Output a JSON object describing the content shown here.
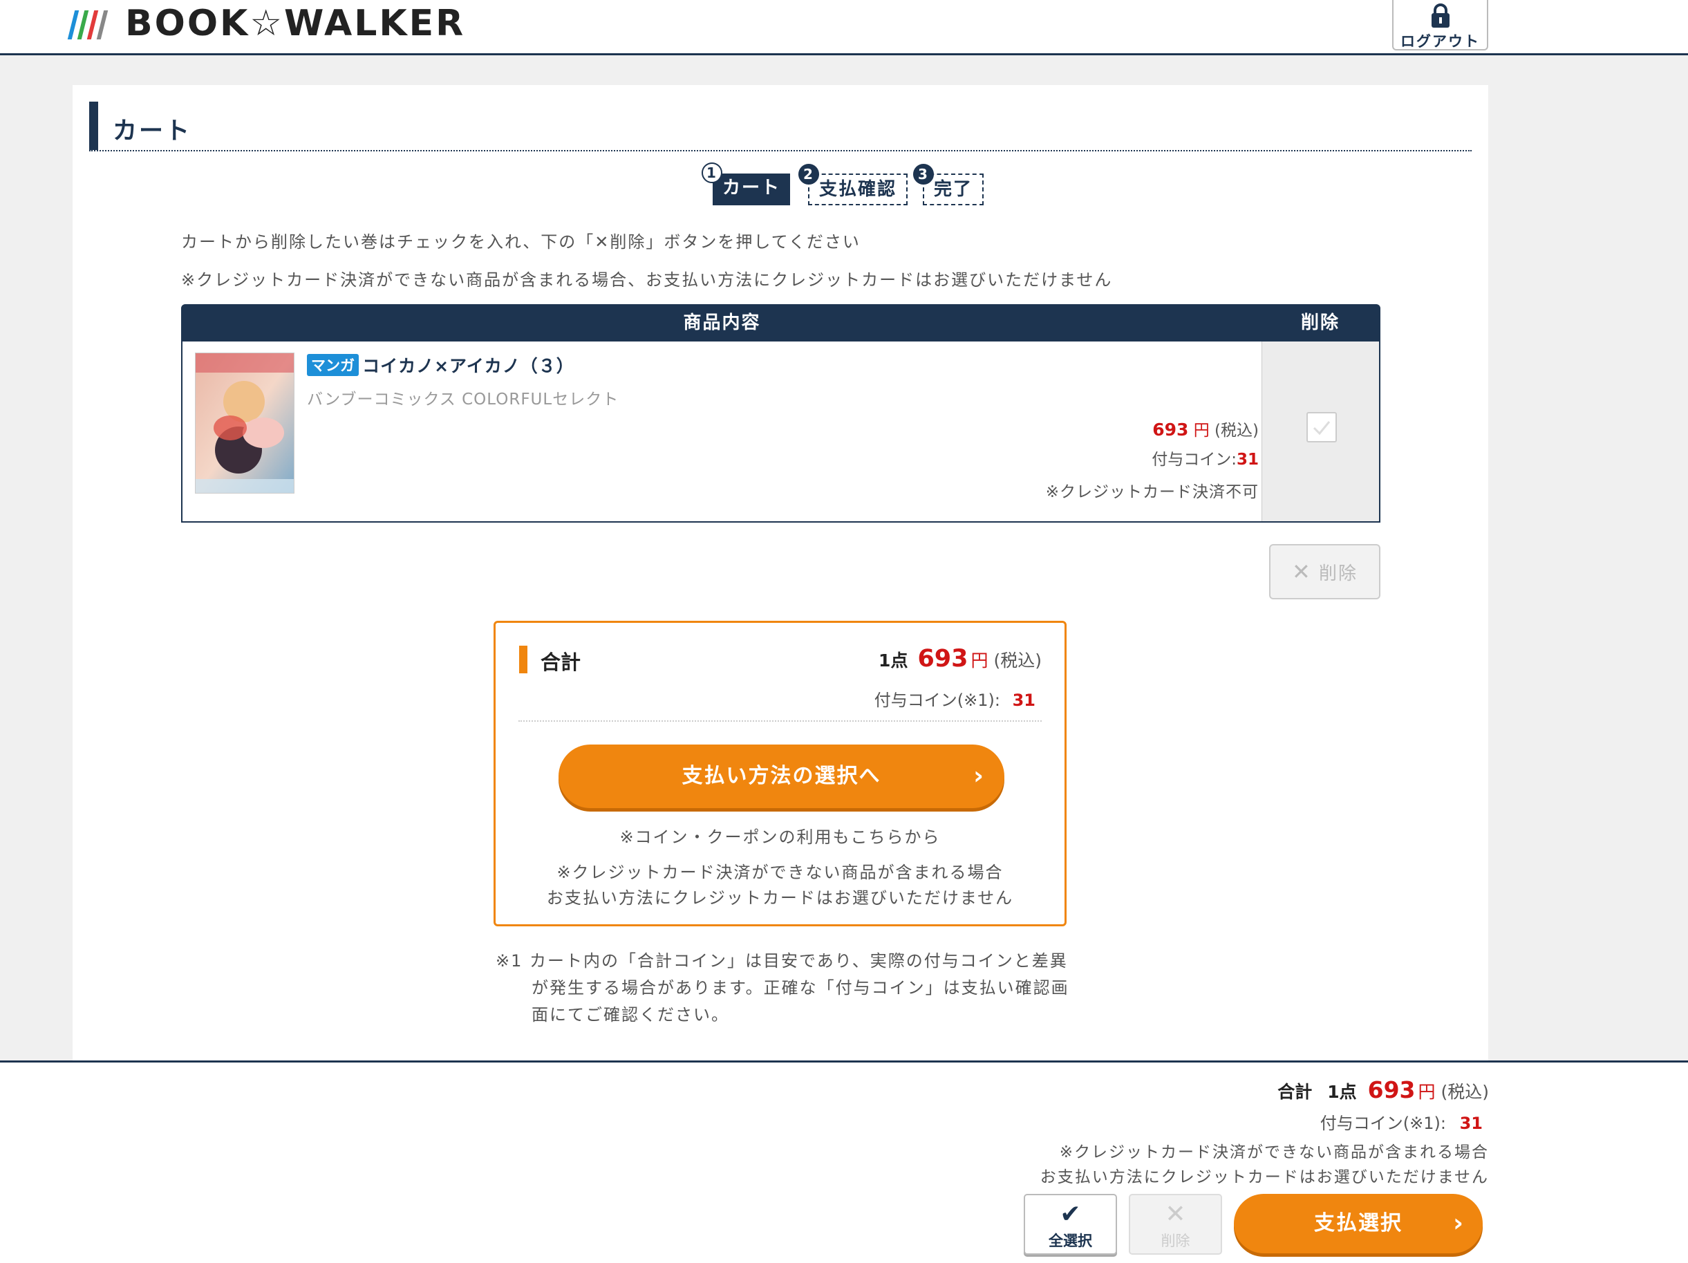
{
  "header": {
    "logo_text": "BOOK☆WALKER",
    "logout_label": "ログアウト"
  },
  "page": {
    "title": "カート"
  },
  "steps": [
    {
      "num": "1",
      "label": "カート"
    },
    {
      "num": "2",
      "label": "支払確認"
    },
    {
      "num": "3",
      "label": "完了"
    }
  ],
  "notes": {
    "delete_instruction": "カートから削除したい巻はチェックを入れ、下の「✕削除」ボタンを押してください",
    "credit_warning": "※クレジットカード決済ができない商品が含まれる場合、お支払い方法にクレジットカードはお選びいただけません"
  },
  "table": {
    "col_content": "商品内容",
    "col_delete": "削除",
    "items": [
      {
        "badge": "マンガ",
        "title": "コイカノ×アイカノ（３）",
        "series": "バンブーコミックス COLORFULセレクト",
        "price": "693",
        "yen": "円",
        "tax": "(税込)",
        "coin_label": "付与コイン:",
        "coin": "31",
        "credit_note": "※クレジットカード決済不可"
      }
    ]
  },
  "delete_button": "削除",
  "summary": {
    "label": "合計",
    "count": "1点",
    "price": "693",
    "yen": "円",
    "tax": "(税込)",
    "coin_label": "付与コイン(※1):",
    "coin": "31",
    "pay_button": "支払い方法の選択へ",
    "coupon_note": "※コイン・クーポンの利用もこちらから",
    "credit_note_1": "※クレジットカード決済ができない商品が含まれる場合",
    "credit_note_2": "お支払い方法にクレジットカードはお選びいただけません"
  },
  "footnote": {
    "line1": "※1 カート内の「合計コイン」は目安であり、実際の付与コインと差異",
    "line2": "が発生する場合があります。正確な「付与コイン」は支払い確認画",
    "line3": "面にてご確認ください。"
  },
  "bottom_bar": {
    "total_label": "合計",
    "count": "1点",
    "price": "693",
    "yen": "円",
    "tax": "(税込)",
    "coin_label": "付与コイン(※1):",
    "coin": "31",
    "credit_note_1": "※クレジットカード決済ができない商品が含まれる場合",
    "credit_note_2": "お支払い方法にクレジットカードはお選びいただけません",
    "select_all": "全選択",
    "delete": "削除",
    "pay_select": "支払選択"
  },
  "colors": {
    "navy": "#1d3450",
    "orange": "#f0860f",
    "price_red": "#d01515",
    "badge_blue": "#1d8fd8"
  }
}
